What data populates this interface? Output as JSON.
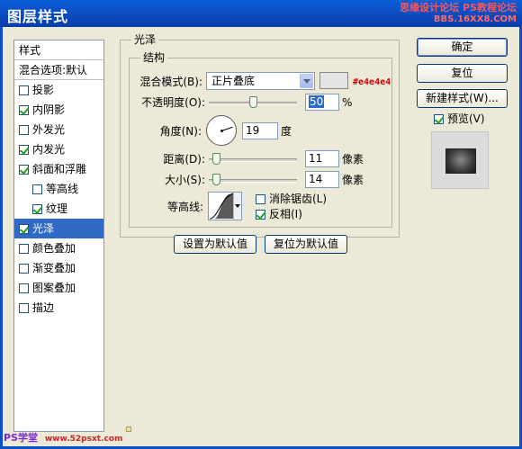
{
  "window": {
    "title": "图层样式",
    "watermark_top": "思缘设计论坛",
    "watermark_top_sub": "BBS.16XX8.COM",
    "watermark_top_ps": "PS教程论坛"
  },
  "sidebar": {
    "header": "样式",
    "blend_options": "混合选项:默认",
    "items": [
      {
        "label": "投影",
        "checked": false,
        "sub": false,
        "active": false
      },
      {
        "label": "内阴影",
        "checked": true,
        "sub": false,
        "active": false
      },
      {
        "label": "外发光",
        "checked": false,
        "sub": false,
        "active": false
      },
      {
        "label": "内发光",
        "checked": true,
        "sub": false,
        "active": false
      },
      {
        "label": "斜面和浮雕",
        "checked": true,
        "sub": false,
        "active": false
      },
      {
        "label": "等高线",
        "checked": false,
        "sub": true,
        "active": false
      },
      {
        "label": "纹理",
        "checked": true,
        "sub": true,
        "active": false
      },
      {
        "label": "光泽",
        "checked": true,
        "sub": false,
        "active": true
      },
      {
        "label": "颜色叠加",
        "checked": false,
        "sub": false,
        "active": false
      },
      {
        "label": "渐变叠加",
        "checked": false,
        "sub": false,
        "active": false
      },
      {
        "label": "图案叠加",
        "checked": false,
        "sub": false,
        "active": false
      },
      {
        "label": "描边",
        "checked": false,
        "sub": false,
        "active": false
      }
    ]
  },
  "satin": {
    "group_title": "光泽",
    "structure_title": "结构",
    "blend_mode_label": "混合模式(B):",
    "blend_mode_value": "正片叠底",
    "color": "#e4e4e4",
    "color_hex_label": "#e4e4e4",
    "opacity_label": "不透明度(O):",
    "opacity_value": "50",
    "opacity_unit": "%",
    "opacity_fraction": 0.5,
    "angle_label": "角度(N):",
    "angle_value": "19",
    "angle_unit": "度",
    "angle_degrees": 19,
    "distance_label": "距离(D):",
    "distance_value": "11",
    "distance_unit": "像素",
    "distance_fraction": 0.04,
    "size_label": "大小(S):",
    "size_value": "14",
    "size_unit": "像素",
    "size_fraction": 0.05,
    "contour_label": "等高线:",
    "antialias_label": "消除锯齿(L)",
    "antialias_checked": false,
    "invert_label": "反相(I)",
    "invert_checked": true
  },
  "defaults": {
    "make_default": "设置为默认值",
    "reset_default": "复位为默认值"
  },
  "actions": {
    "ok": "确定",
    "reset": "复位",
    "new_style": "新建样式(W)...",
    "preview_label": "预览(V)",
    "preview_checked": true
  },
  "watermark_bottom": {
    "brand": "PS学堂",
    "site": "www.52psxt.com"
  }
}
